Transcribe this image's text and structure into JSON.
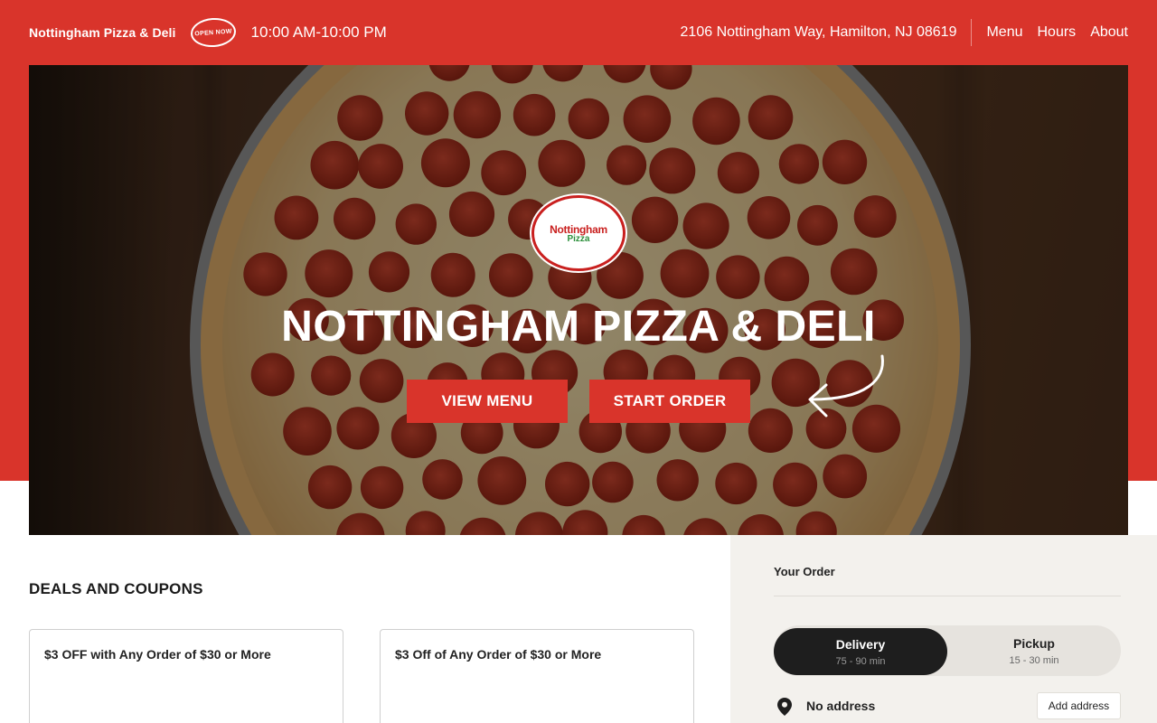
{
  "header": {
    "brand": "Nottingham Pizza & Deli",
    "badge": "OPEN NOW",
    "hours": "10:00 AM-10:00 PM",
    "address": "2106 Nottingham Way, Hamilton, NJ 08619",
    "nav": [
      {
        "label": "Menu"
      },
      {
        "label": "Hours"
      },
      {
        "label": "About"
      }
    ]
  },
  "hero": {
    "logo_line1": "Nottingham",
    "logo_line2": "Pizza",
    "title": "NOTTINGHAM PIZZA & DELI",
    "view_menu": "VIEW MENU",
    "start_order": "START ORDER"
  },
  "deals": {
    "title": "DEALS AND COUPONS",
    "cards": [
      {
        "text": "$3 OFF with Any Order of $30 or More"
      },
      {
        "text": "$3 Off of Any Order of $30 or More"
      }
    ]
  },
  "order": {
    "title": "Your Order",
    "delivery_label": "Delivery",
    "delivery_time": "75 - 90 min",
    "pickup_label": "Pickup",
    "pickup_time": "15 - 30 min",
    "no_address": "No address",
    "add_address": "Add address"
  },
  "colors": {
    "brand_red": "#d9342b",
    "toggle_active": "#1e1e1e",
    "panel_bg": "#f3f1ed"
  }
}
